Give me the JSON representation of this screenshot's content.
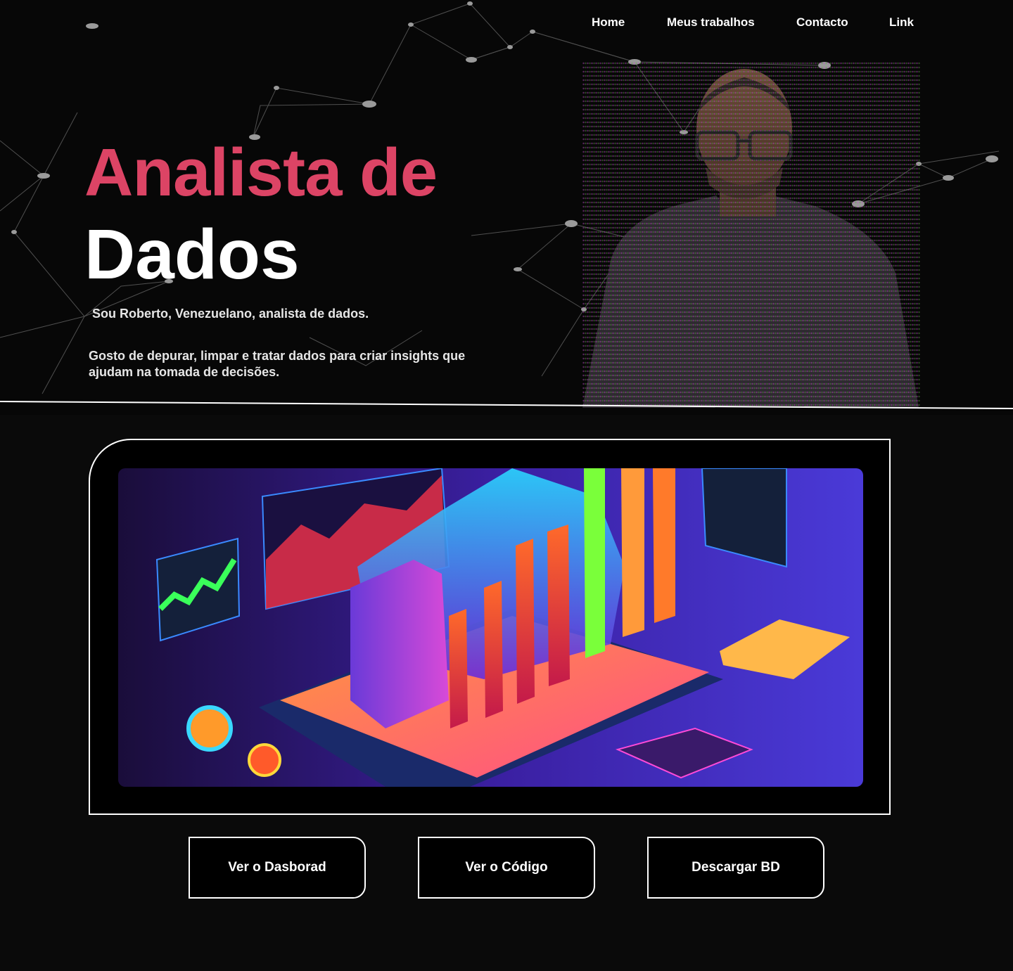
{
  "nav": {
    "items": [
      {
        "label": "Home"
      },
      {
        "label": "Meus trabalhos"
      },
      {
        "label": "Contacto"
      },
      {
        "label": "Link"
      }
    ]
  },
  "hero": {
    "title_line1": "Analista de",
    "title_line2": "Dados",
    "intro": "Sou Roberto, Venezuelano,  analista de dados.",
    "description": "Gosto de depurar, limpar e tratar dados para criar insights que ajudam na tomada de decisões."
  },
  "project": {
    "image_alt": "isometric-data-analytics-illustration"
  },
  "actions": {
    "dashboard_label": "Ver o Dasborad",
    "code_label": "Ver o  Código",
    "download_label": "Descargar BD"
  },
  "colors": {
    "accent": "#dc4465",
    "background": "#0a0a0a"
  }
}
